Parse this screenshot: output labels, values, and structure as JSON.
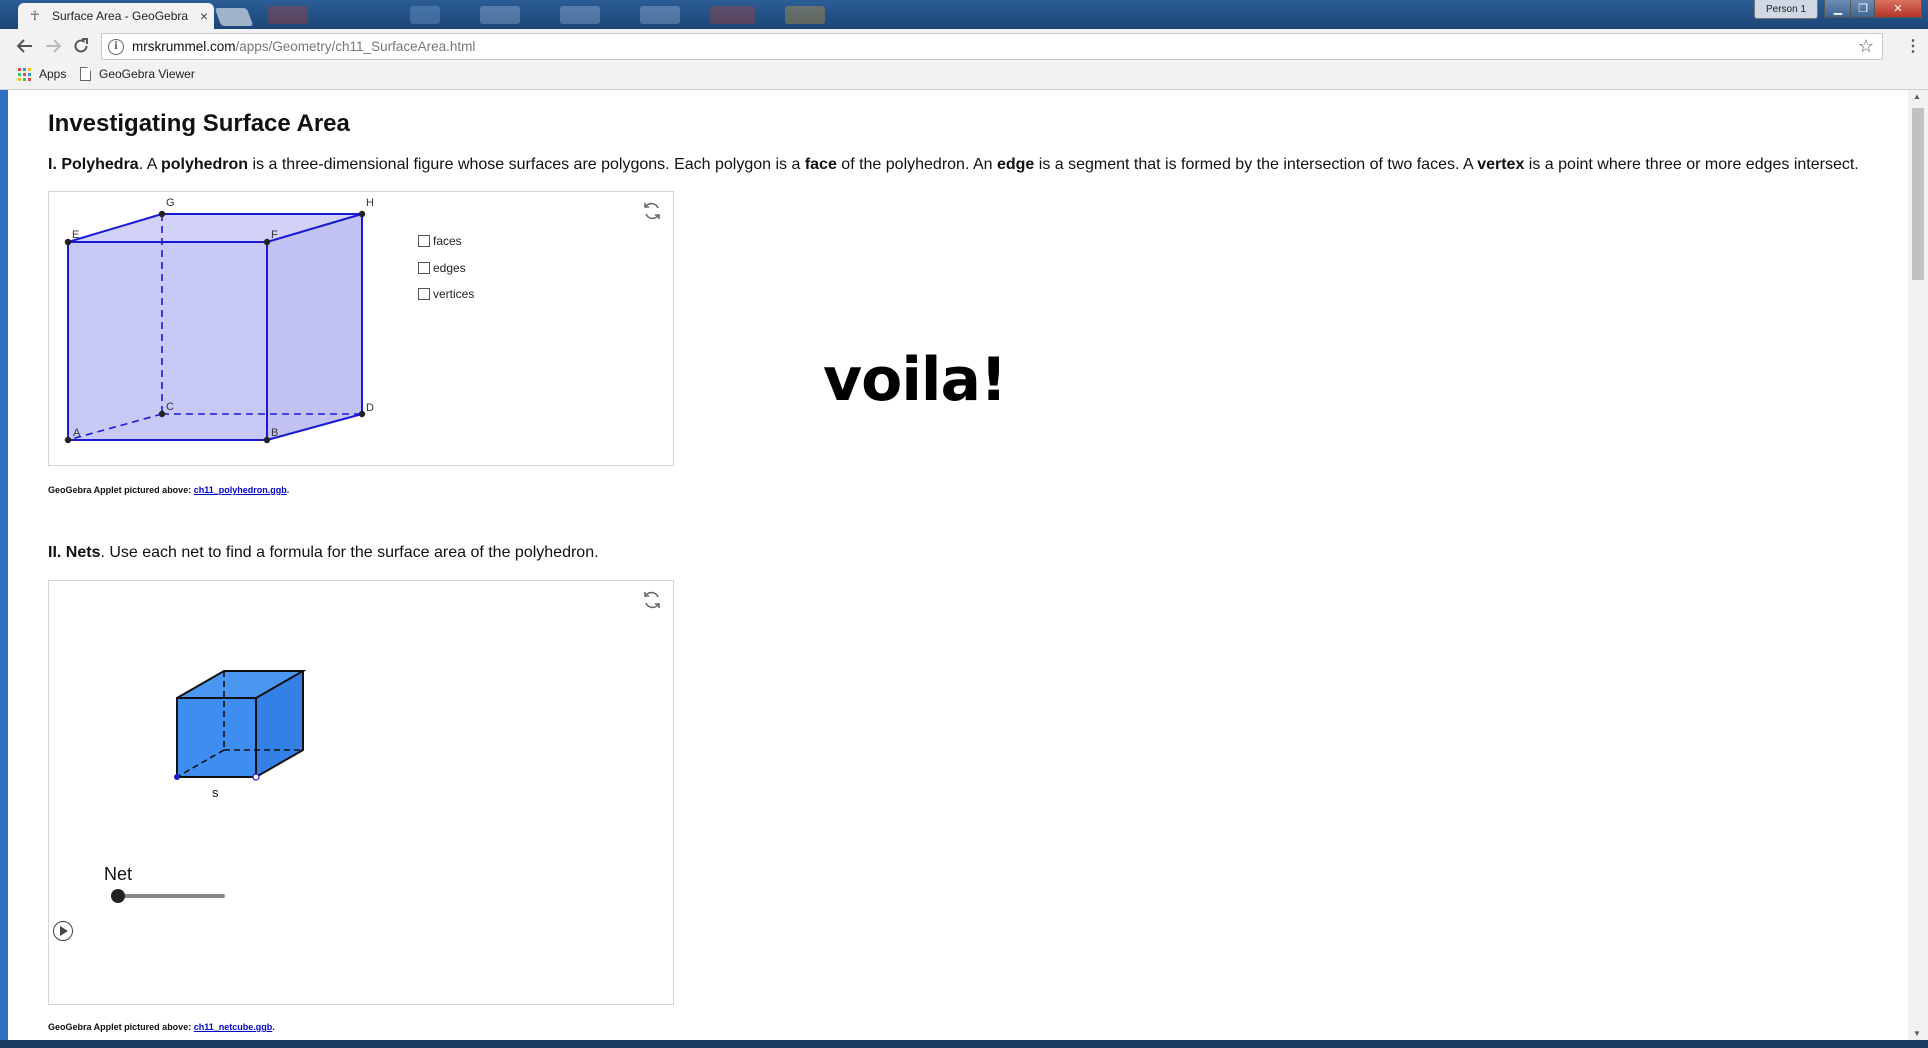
{
  "browser": {
    "tab_title": "Surface Area - GeoGebra",
    "tab_close": "×",
    "profile_label": "Person 1",
    "url_host": "mrskrummel.com",
    "url_path": "/apps/Geometry/ch11_SurfaceArea.html",
    "bookmarks": {
      "apps_label": "Apps",
      "item1": "GeoGebra Viewer"
    }
  },
  "page": {
    "title": "Investigating Surface Area",
    "section1": {
      "heading": "I. Polyhedra",
      "text_a": ". A ",
      "term_polyhedron": "polyhedron",
      "text_b": " is a three-dimensional figure whose surfaces are polygons. Each polygon is a ",
      "term_face": "face",
      "text_c": " of the polyhedron. An ",
      "term_edge": "edge",
      "text_d": " is a segment that is formed by the intersection of two faces. A ",
      "term_vertex": "vertex",
      "text_e": " is a point where three or more edges intersect."
    },
    "applet1": {
      "checkboxes": [
        "faces",
        "edges",
        "vertices"
      ],
      "vertex_labels": {
        "A": "A",
        "B": "B",
        "C": "C",
        "D": "D",
        "E": "E",
        "F": "F",
        "G": "G",
        "H": "H"
      },
      "caption_prefix": "GeoGebra Applet pictured above: ",
      "caption_link": "ch11_polyhedron.ggb",
      "caption_suffix": "."
    },
    "overlay_text": "voila!",
    "section2": {
      "heading": "II. Nets",
      "text": ". Use each net to find a formula for the surface area of the polyhedron."
    },
    "applet2": {
      "edge_label": "s",
      "slider_label": "Net",
      "slider_value": 0,
      "caption_prefix": "GeoGebra Applet pictured above: ",
      "caption_link": "ch11_netcube.ggb",
      "caption_suffix": "."
    }
  },
  "colors": {
    "titlebar": "#1c4677",
    "face_fill_light": "#c9c9f7",
    "edge_blue": "#1a1ad6",
    "cube_blue": "#3d8ef0",
    "link": "#0000cc"
  }
}
